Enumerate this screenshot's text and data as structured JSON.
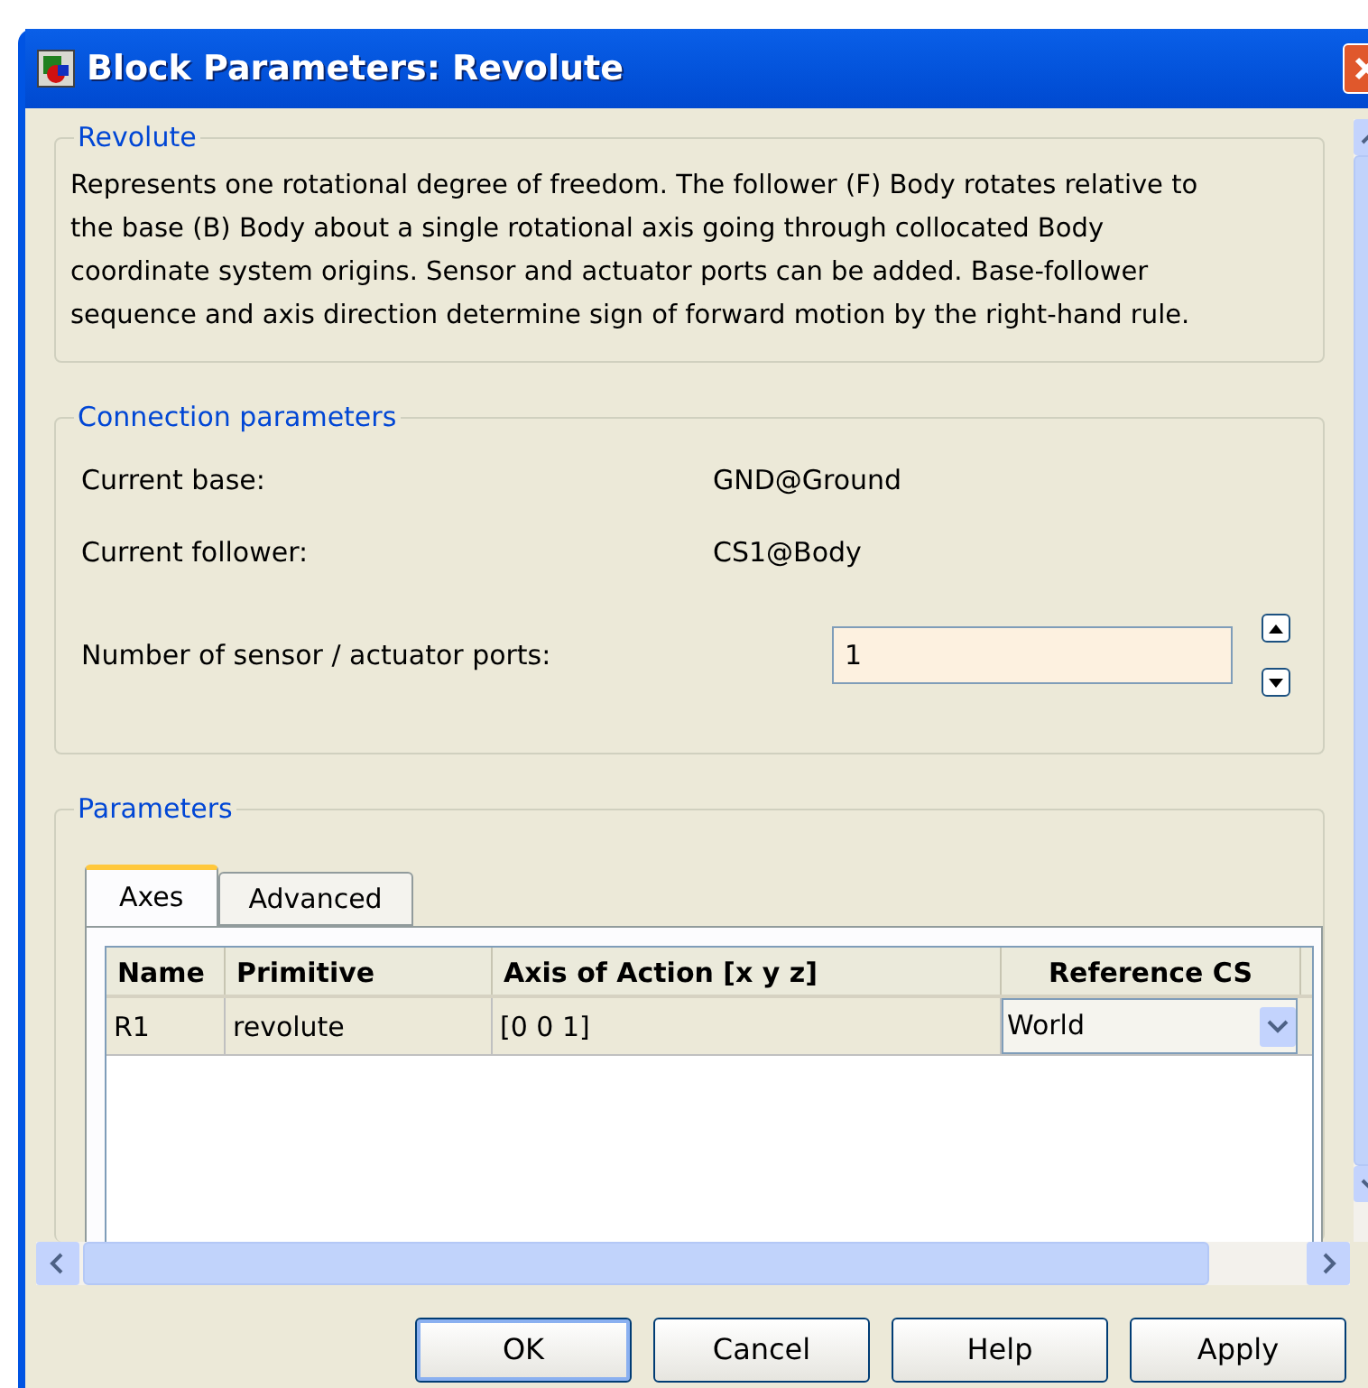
{
  "window": {
    "title": "Block Parameters: Revolute"
  },
  "description_group": {
    "title": "Revolute",
    "text": "Represents one rotational degree of freedom. The follower (F) Body rotates relative to the base (B) Body about a single rotational axis going through collocated Body coordinate system origins. Sensor and actuator ports can be added. Base-follower sequence and axis direction determine sign of forward motion by the right-hand rule."
  },
  "connection_group": {
    "title": "Connection parameters",
    "rows": [
      {
        "label": "Current base:",
        "value": "GND@Ground"
      },
      {
        "label": "Current follower:",
        "value": "CS1@Body"
      }
    ],
    "ports_field": {
      "label": "Number of sensor / actuator ports:",
      "value": "1"
    }
  },
  "parameters_group": {
    "title": "Parameters",
    "tabs": [
      {
        "label": "Axes",
        "selected": true
      },
      {
        "label": "Advanced",
        "selected": false
      }
    ],
    "table": {
      "columns": [
        "Name",
        "Primitive",
        "Axis of Action [x y z]",
        "Reference CS"
      ],
      "rows": [
        {
          "name": "R1",
          "primitive": "revolute",
          "axis": "[0 0 1]",
          "reference": "World"
        }
      ]
    }
  },
  "buttons": [
    "OK",
    "Cancel",
    "Help",
    "Apply"
  ]
}
